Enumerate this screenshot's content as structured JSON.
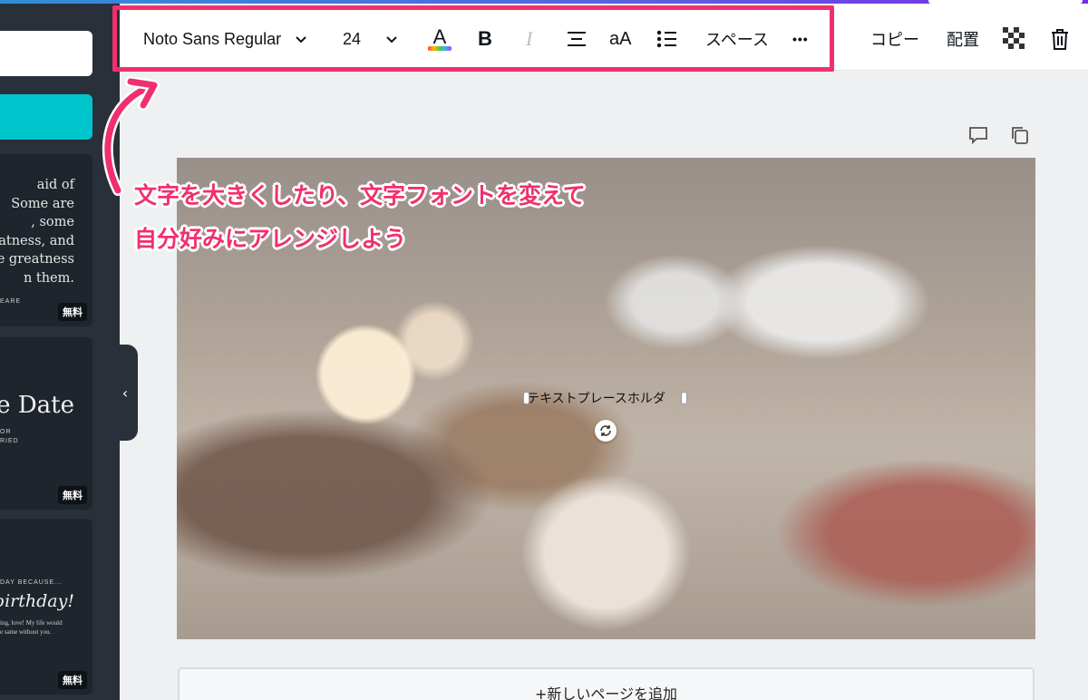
{
  "toolbar": {
    "font_name": "Noto Sans Regular",
    "font_size": "24",
    "spacing_label": "スペース",
    "more_label": "•••",
    "copy_label": "コピー",
    "arrange_label": "配置",
    "bold_label": "B",
    "italic_label": "I",
    "case_label": "aA",
    "text_color_letter": "A"
  },
  "sidebar": {
    "templates": [
      {
        "quote": "aid of\nSome are\n, some\neatness, and\ne greatness\nn them.",
        "author": "EARE",
        "badge": "無料"
      },
      {
        "title": "he Date",
        "sub": "OR\nRIED",
        "badge": "無料"
      },
      {
        "top": "DAY BECAUSE...",
        "title": "birthday!",
        "sub": "ing, love! My life would\ne same without you.",
        "badge": "無料"
      }
    ],
    "collapse_glyph": "‹"
  },
  "canvas": {
    "text_placeholder": "テキストプレースホルダ"
  },
  "add_page_label": "+新しいページを追加",
  "annotation": {
    "line1": "文字を大きくしたり、文字フォントを変えて",
    "line2": "自分好みにアレンジしよう"
  },
  "colors": {
    "accent_pink": "#f0306e",
    "sidebar": "#293039",
    "teal": "#00c4cc"
  },
  "icons": [
    "chevron-down-icon",
    "text-color-icon",
    "align-center-icon",
    "list-icon",
    "more-icon",
    "transparency-icon",
    "trash-icon",
    "comment-icon",
    "duplicate-icon",
    "rotate-icon"
  ]
}
